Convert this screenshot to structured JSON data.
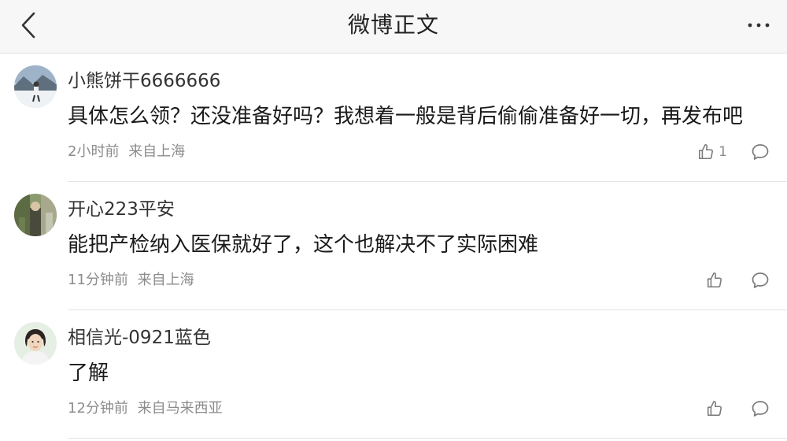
{
  "header": {
    "title": "微博正文",
    "back_icon": "chevron-left-icon",
    "more_icon": "ellipsis-icon"
  },
  "colors": {
    "header_bg": "#f7f7f7",
    "text_primary": "#1a1a1a",
    "text_secondary": "#8c8c8c",
    "divider": "#e4e4e4"
  },
  "comments": [
    {
      "username": "小熊饼干6666666",
      "text": "具体怎么领？还没准备好吗？我想着一般是背后偷偷准备好一切，再发布吧",
      "time": "2小时前",
      "location": "来自上海",
      "like_count": "1"
    },
    {
      "username": "开心223平安",
      "text": "能把产检纳入医保就好了，这个也解决不了实际困难",
      "time": "11分钟前",
      "location": "来自上海",
      "like_count": ""
    },
    {
      "username": "相信光-0921蓝色",
      "text": "了解",
      "time": "12分钟前",
      "location": "来自马来西亚",
      "like_count": ""
    }
  ]
}
